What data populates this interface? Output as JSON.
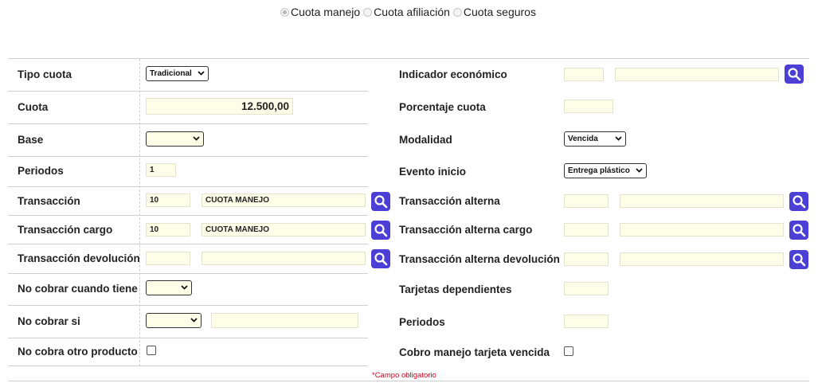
{
  "fee_type_selector": {
    "options": [
      "Cuota manejo",
      "Cuota afiliación",
      "Cuota seguros"
    ],
    "selected_index": 0
  },
  "left": {
    "tipo_cuota": {
      "label": "Tipo cuota",
      "value": "Tradicional"
    },
    "cuota": {
      "label": "Cuota",
      "value": "12.500,00"
    },
    "base": {
      "label": "Base",
      "value": ""
    },
    "periodos": {
      "label": "Periodos",
      "value": "1"
    },
    "transaccion": {
      "label": "Transacción",
      "code": "10",
      "description": "CUOTA MANEJO"
    },
    "transaccion_cargo": {
      "label": "Transacción cargo",
      "code": "10",
      "description": "CUOTA MANEJO"
    },
    "transaccion_devolucion": {
      "label": "Transacción devolución",
      "code": "",
      "description": ""
    },
    "no_cobrar_cuando_tiene": {
      "label": "No cobrar cuando tiene",
      "value": ""
    },
    "no_cobrar_si": {
      "label": "No cobrar si",
      "value": "",
      "extra": ""
    },
    "no_cobra_otro_producto": {
      "label": "No cobra otro producto",
      "checked": false
    }
  },
  "right": {
    "indicador_economico": {
      "label": "Indicador económico",
      "code": "",
      "description": ""
    },
    "porcentaje_cuota": {
      "label": "Porcentaje cuota",
      "value": ""
    },
    "modalidad": {
      "label": "Modalidad",
      "value": "Vencida"
    },
    "evento_inicio": {
      "label": "Evento inicio",
      "value": "Entrega plástico"
    },
    "transaccion_alterna": {
      "label": "Transacción alterna",
      "code": "",
      "description": ""
    },
    "transaccion_alterna_cargo": {
      "label": "Transacción alterna cargo",
      "code": "",
      "description": ""
    },
    "transaccion_alterna_devolucion": {
      "label": "Transacción alterna devolución",
      "code": "",
      "description": ""
    },
    "tarjetas_dependientes": {
      "label": "Tarjetas dependientes",
      "value": ""
    },
    "periodos": {
      "label": "Periodos",
      "value": ""
    },
    "cobro_manejo_tarjeta_vencida": {
      "label": "Cobro manejo tarjeta vencida",
      "checked": false
    }
  },
  "footnote": "*Campo obligatorio",
  "colors": {
    "accent": "#4b3fd6",
    "field_bg": "#fdfde8",
    "required": "#d0021b"
  },
  "icons": {
    "search": "search-icon",
    "chevron": "chevron-down-icon"
  }
}
